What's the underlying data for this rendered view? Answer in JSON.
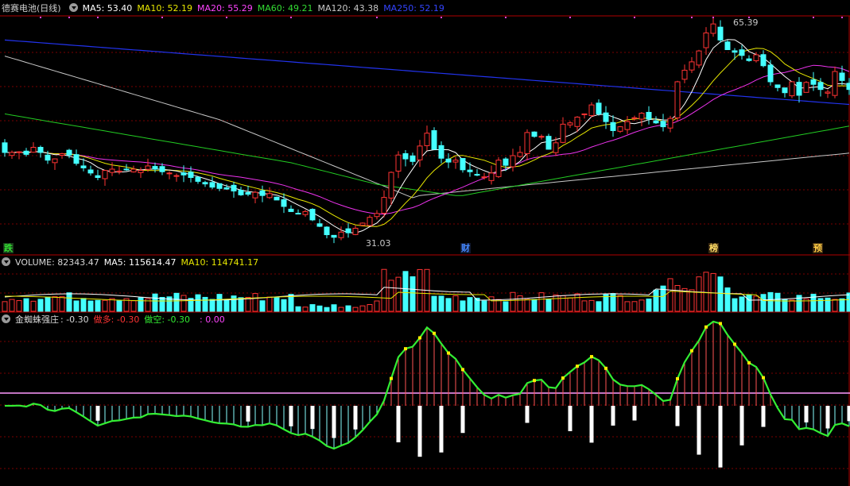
{
  "price_panel": {
    "stock_name": "德赛电池(日线)",
    "ma_items": [
      {
        "label": "MA5: 53.40",
        "color": "#ffffff"
      },
      {
        "label": "MA10: 52.19",
        "color": "#e8e800"
      },
      {
        "label": "MA20: 55.29",
        "color": "#ff44ff"
      },
      {
        "label": "MA60: 49.21",
        "color": "#33dd33"
      },
      {
        "label": "MA120: 43.38",
        "color": "#c8c8c8"
      },
      {
        "label": "MA250: 52.19",
        "color": "#3344ff"
      }
    ],
    "high_label": "65.39",
    "low_label": "31.03",
    "event_markers": [
      {
        "text": "跌",
        "color": "#33dd33",
        "bg": "#1a3a1a"
      },
      {
        "text": "财",
        "color": "#4488ff",
        "bg": "#101830"
      },
      {
        "text": "榜",
        "color": "#ffdd66",
        "bg": "#3a2810"
      },
      {
        "text": "预",
        "color": "#ffcc44",
        "bg": "#3a2810"
      }
    ]
  },
  "volume_panel": {
    "label": "VOLUME: 82343.47",
    "ma5": "MA5: 115614.47",
    "ma10": "MA10: 114741.17"
  },
  "indicator_panel": {
    "label": "金蜘蛛强庄",
    "value": ": -0.30",
    "long_label": "做多: -0.30",
    "short_label": "做空: -0.30",
    "extra_label": ": 0.00"
  },
  "colors": {
    "up": "#ff3333",
    "down": "#44ffff",
    "grid": "#7a0000",
    "panel_border": "#b00000"
  },
  "chart_data": {
    "type": "candlestick",
    "closes": [
      45.0,
      45.0,
      45.1,
      44.7,
      45.8,
      45.0,
      43.8,
      44.0,
      44.8,
      44.6,
      43.3,
      42.6,
      41.8,
      41.1,
      42.2,
      42.4,
      42.1,
      42.3,
      42.4,
      42.2,
      42.9,
      42.4,
      42.0,
      41.8,
      41.4,
      41.5,
      41.1,
      40.5,
      40.1,
      39.6,
      39.4,
      39.3,
      39.0,
      38.4,
      38.5,
      38.8,
      38.3,
      38.6,
      37.6,
      36.6,
      35.8,
      35.5,
      35.8,
      34.5,
      33.5,
      32.2,
      31.8,
      32.6,
      32.5,
      33.2,
      34.0,
      34.9,
      35.5,
      38.0,
      41.9,
      44.6,
      44.0,
      43.6,
      46.0,
      48.0,
      45.5,
      44.1,
      43.5,
      43.8,
      42.3,
      42.0,
      41.5,
      41.2,
      41.8,
      43.8,
      43.0,
      44.5,
      45.0,
      48.1,
      47.5,
      47.5,
      45.5,
      46.5,
      49.4,
      49.6,
      50.5,
      51.0,
      52.4,
      51.0,
      49.8,
      48.4,
      49.0,
      49.8,
      50.4,
      51.1,
      50.2,
      49.6,
      49.0,
      50.3,
      56.0,
      57.8,
      59.1,
      60.8,
      63.6,
      65.0,
      62.5,
      61.0,
      60.6,
      60.1,
      59.3,
      60.2,
      58.5,
      56.0,
      55.1,
      54.3,
      56.0,
      53.9,
      55.9,
      55.6,
      54.8,
      54.4,
      57.6,
      56.2,
      54.8
    ]
  }
}
